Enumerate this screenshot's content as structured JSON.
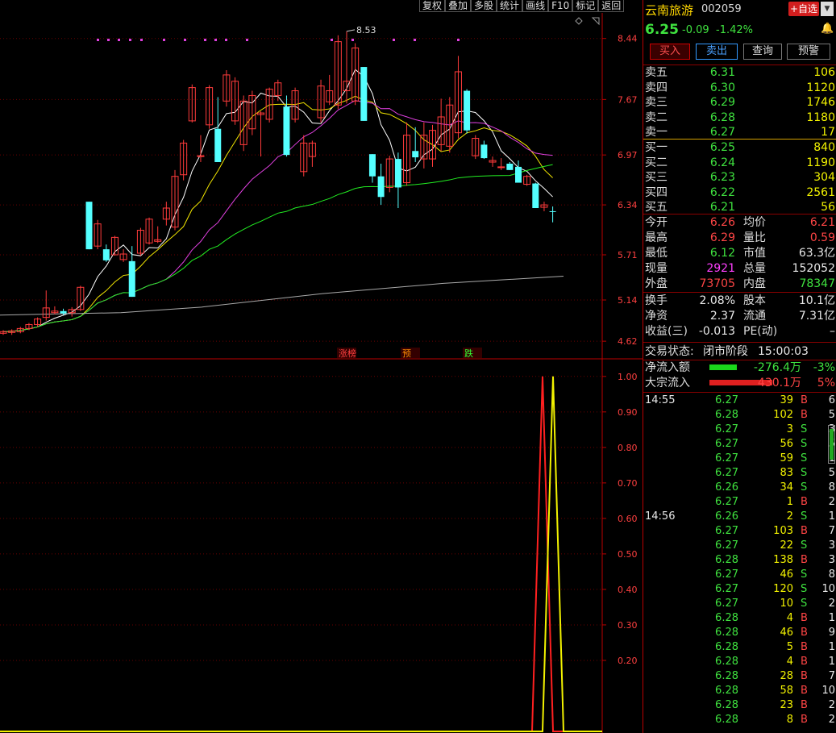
{
  "toolbar": {
    "items": [
      "复权",
      "叠加",
      "多股",
      "统计",
      "画线",
      "F10",
      "标记",
      "返回"
    ]
  },
  "stock": {
    "name": "云南旅游",
    "code": "002059",
    "price": "6.25",
    "change": "-0.09",
    "change_pct": "-1.42%",
    "add_fav": "+自选"
  },
  "actions": {
    "buy": "买入",
    "sell": "卖出",
    "query": "查询",
    "alert": "预警"
  },
  "order_book": {
    "asks": [
      {
        "label": "卖五",
        "price": "6.31",
        "vol": "106"
      },
      {
        "label": "卖四",
        "price": "6.30",
        "vol": "1120"
      },
      {
        "label": "卖三",
        "price": "6.29",
        "vol": "1746"
      },
      {
        "label": "卖二",
        "price": "6.28",
        "vol": "1180"
      },
      {
        "label": "卖一",
        "price": "6.27",
        "vol": "17"
      }
    ],
    "bids": [
      {
        "label": "买一",
        "price": "6.25",
        "vol": "840"
      },
      {
        "label": "买二",
        "price": "6.24",
        "vol": "1190"
      },
      {
        "label": "买三",
        "price": "6.23",
        "vol": "304"
      },
      {
        "label": "买四",
        "price": "6.22",
        "vol": "2561"
      },
      {
        "label": "买五",
        "price": "6.21",
        "vol": "56"
      }
    ]
  },
  "quote": {
    "open_l": "今开",
    "open": "6.26",
    "avg_l": "均价",
    "avg": "6.21",
    "high_l": "最高",
    "high": "6.29",
    "vr_l": "量比",
    "vr": "0.59",
    "low_l": "最低",
    "low": "6.12",
    "mcap_l": "市值",
    "mcap": "63.3亿",
    "cur_l": "现量",
    "cur": "2921",
    "tvol_l": "总量",
    "tvol": "152052",
    "out_l": "外盘",
    "out": "73705",
    "in_l": "内盘",
    "in": "78347"
  },
  "fund": {
    "turn_l": "换手",
    "turn": "2.08%",
    "cap_l": "股本",
    "cap": "10.1亿",
    "nav_l": "净资",
    "nav": "2.37",
    "float_l": "流通",
    "float": "7.31亿",
    "eps_l": "收益(三)",
    "eps": "-0.013",
    "pe_l": "PE(动)",
    "pe": "–"
  },
  "status": {
    "label": "交易状态:",
    "value": "闭市阶段",
    "time": "15:00:03"
  },
  "flows": {
    "net_l": "净流入额",
    "net": "-276.4万",
    "net_pct": "-3%",
    "block_l": "大宗流入",
    "block": "430.1万",
    "block_pct": "5%"
  },
  "ticks": [
    {
      "time": "14:55",
      "price": "6.27",
      "vol": "39",
      "bs": "B",
      "n": "6"
    },
    {
      "time": "",
      "price": "6.28",
      "vol": "102",
      "bs": "B",
      "n": "5"
    },
    {
      "time": "",
      "price": "6.27",
      "vol": "3",
      "bs": "S",
      "n": "3"
    },
    {
      "time": "",
      "price": "6.27",
      "vol": "56",
      "bs": "S",
      "n": "5"
    },
    {
      "time": "",
      "price": "6.27",
      "vol": "59",
      "bs": "S",
      "n": "1"
    },
    {
      "time": "",
      "price": "6.27",
      "vol": "83",
      "bs": "S",
      "n": "5"
    },
    {
      "time": "",
      "price": "6.26",
      "vol": "34",
      "bs": "S",
      "n": "8"
    },
    {
      "time": "",
      "price": "6.27",
      "vol": "1",
      "bs": "B",
      "n": "2"
    },
    {
      "time": "14:56",
      "price": "6.26",
      "vol": "2",
      "bs": "S",
      "n": "1"
    },
    {
      "time": "",
      "price": "6.27",
      "vol": "103",
      "bs": "B",
      "n": "7"
    },
    {
      "time": "",
      "price": "6.27",
      "vol": "22",
      "bs": "S",
      "n": "3"
    },
    {
      "time": "",
      "price": "6.28",
      "vol": "138",
      "bs": "B",
      "n": "3"
    },
    {
      "time": "",
      "price": "6.27",
      "vol": "46",
      "bs": "S",
      "n": "8"
    },
    {
      "time": "",
      "price": "6.27",
      "vol": "120",
      "bs": "S",
      "n": "10"
    },
    {
      "time": "",
      "price": "6.27",
      "vol": "10",
      "bs": "S",
      "n": "2"
    },
    {
      "time": "",
      "price": "6.28",
      "vol": "4",
      "bs": "B",
      "n": "1"
    },
    {
      "time": "",
      "price": "6.28",
      "vol": "46",
      "bs": "B",
      "n": "9"
    },
    {
      "time": "",
      "price": "6.28",
      "vol": "5",
      "bs": "B",
      "n": "1"
    },
    {
      "time": "",
      "price": "6.28",
      "vol": "4",
      "bs": "B",
      "n": "1"
    },
    {
      "time": "",
      "price": "6.28",
      "vol": "28",
      "bs": "B",
      "n": "7"
    },
    {
      "time": "",
      "price": "6.28",
      "vol": "58",
      "bs": "B",
      "n": "10"
    },
    {
      "time": "",
      "price": "6.28",
      "vol": "23",
      "bs": "B",
      "n": "2"
    },
    {
      "time": "",
      "price": "6.28",
      "vol": "8",
      "bs": "B",
      "n": "2"
    }
  ],
  "chart_data": [
    {
      "type": "candlestick",
      "price_axis": [
        "8.44",
        "7.67",
        "6.97",
        "6.34",
        "5.71",
        "5.14",
        "4.62"
      ],
      "max_label": "8.53",
      "ylim": [
        4.55,
        8.62
      ],
      "markers": [
        "涨榜",
        "预",
        "跌"
      ],
      "candles": [
        [
          4.72,
          4.76,
          4.7,
          4.74
        ],
        [
          4.73,
          4.77,
          4.7,
          4.75
        ],
        [
          4.74,
          4.8,
          4.72,
          4.78
        ],
        [
          4.78,
          4.85,
          4.76,
          4.83
        ],
        [
          4.83,
          4.92,
          4.8,
          4.9
        ],
        [
          4.92,
          5.26,
          4.88,
          5.04
        ],
        [
          4.98,
          5.06,
          4.96,
          5.0
        ],
        [
          5.0,
          5.03,
          4.95,
          4.97
        ],
        [
          4.98,
          5.05,
          4.93,
          5.02
        ],
        [
          5.02,
          5.32,
          5.0,
          5.3
        ],
        [
          6.38,
          6.38,
          5.78,
          5.78
        ],
        [
          5.82,
          6.15,
          5.78,
          6.1
        ],
        [
          5.78,
          5.84,
          5.62,
          5.64
        ],
        [
          5.71,
          5.95,
          5.7,
          5.93
        ],
        [
          5.65,
          5.78,
          5.62,
          5.72
        ],
        [
          5.63,
          5.82,
          5.18,
          5.18
        ],
        [
          5.73,
          6.05,
          5.7,
          6.02
        ],
        [
          5.86,
          6.18,
          5.84,
          6.16
        ],
        [
          5.88,
          6.07,
          5.86,
          5.9
        ],
        [
          6.16,
          6.38,
          6.08,
          6.3
        ],
        [
          6.06,
          6.78,
          6.02,
          6.7
        ],
        [
          6.72,
          7.16,
          6.65,
          7.12
        ],
        [
          7.4,
          7.86,
          7.38,
          7.82
        ],
        [
          6.96,
          7.22,
          6.88,
          6.96
        ],
        [
          7.35,
          7.85,
          7.3,
          7.82
        ],
        [
          7.3,
          7.7,
          6.9,
          6.88
        ],
        [
          7.65,
          8.04,
          7.58,
          7.98
        ],
        [
          7.4,
          7.95,
          7.35,
          7.9
        ],
        [
          7.1,
          7.72,
          7.02,
          7.65
        ],
        [
          7.3,
          7.78,
          7.22,
          7.72
        ],
        [
          7.48,
          7.52,
          6.95,
          7.5
        ],
        [
          7.42,
          7.82,
          7.38,
          7.8
        ],
        [
          7.72,
          7.92,
          7.65,
          7.88
        ],
        [
          7.58,
          7.72,
          6.95,
          6.97
        ],
        [
          7.42,
          7.82,
          7.38,
          7.78
        ],
        [
          6.76,
          7.22,
          6.7,
          7.12
        ],
        [
          6.95,
          7.15,
          6.82,
          7.12
        ],
        [
          7.44,
          7.92,
          7.38,
          7.84
        ],
        [
          7.64,
          7.98,
          7.6,
          7.78
        ],
        [
          7.6,
          8.48,
          7.55,
          8.4
        ],
        [
          7.78,
          8.53,
          7.62,
          7.9
        ],
        [
          7.65,
          8.38,
          7.6,
          8.32
        ],
        [
          8.08,
          8.08,
          7.4,
          7.4
        ],
        [
          6.98,
          6.98,
          6.62,
          6.7
        ],
        [
          6.7,
          6.86,
          6.34,
          6.44
        ],
        [
          6.56,
          6.96,
          6.5,
          6.92
        ],
        [
          6.92,
          7.0,
          6.3,
          6.56
        ],
        [
          6.62,
          7.38,
          6.58,
          7.22
        ],
        [
          7.02,
          7.32,
          6.88,
          6.94
        ],
        [
          6.92,
          7.38,
          6.8,
          7.22
        ],
        [
          6.92,
          7.35,
          6.82,
          7.28
        ],
        [
          7.1,
          7.68,
          7.02,
          7.45
        ],
        [
          7.08,
          7.7,
          7.0,
          7.6
        ],
        [
          7.25,
          8.22,
          7.18,
          8.02
        ],
        [
          7.78,
          7.8,
          7.24,
          7.28
        ],
        [
          6.96,
          7.22,
          6.92,
          7.18
        ],
        [
          7.1,
          7.15,
          6.92,
          6.93
        ],
        [
          6.88,
          6.95,
          6.82,
          6.9
        ],
        [
          6.82,
          6.93,
          6.78,
          6.82
        ],
        [
          6.86,
          6.88,
          6.78,
          6.78
        ],
        [
          6.82,
          6.9,
          6.62,
          6.62
        ],
        [
          6.6,
          6.72,
          6.58,
          6.7
        ],
        [
          6.61,
          6.62,
          6.3,
          6.3
        ],
        [
          6.31,
          6.38,
          6.26,
          6.34
        ],
        [
          6.26,
          6.32,
          6.12,
          6.25
        ]
      ],
      "ma_series": [
        {
          "color": "#ffffff"
        },
        {
          "color": "#f2e600"
        },
        {
          "color": "#e040e0"
        },
        {
          "color": "#22ee22"
        },
        {
          "color": "#aaaaaa"
        }
      ]
    },
    {
      "type": "line",
      "y_axis": [
        "1.00",
        "0.90",
        "0.80",
        "0.70",
        "0.60",
        "0.50",
        "0.40",
        "0.30",
        "0.20"
      ],
      "ylim": [
        0,
        1.02
      ],
      "series": [
        {
          "color": "#ff2020",
          "points": [
            [
              0,
              0
            ],
            [
              660,
              0
            ],
            [
              673,
              1.0
            ],
            [
              686,
              0
            ],
            [
              1037,
              0
            ]
          ]
        },
        {
          "color": "#f2f200",
          "points": [
            [
              0,
              0
            ],
            [
              673,
              0
            ],
            [
              686,
              1.0
            ],
            [
              699,
              0
            ],
            [
              1037,
              0
            ]
          ]
        }
      ]
    }
  ]
}
